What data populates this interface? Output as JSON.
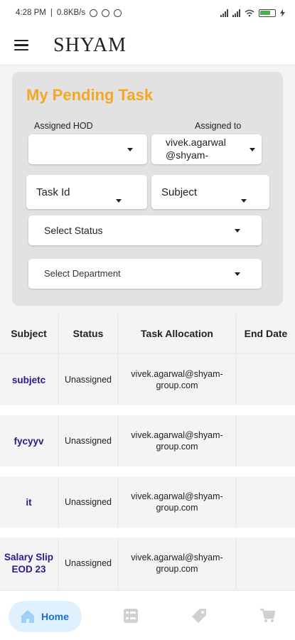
{
  "status_bar": {
    "time": "4:28 PM",
    "speed": "0.8KB/s",
    "battery": "71"
  },
  "app_bar": {
    "brand": "SHYAM"
  },
  "filters": {
    "title": "My Pending Task",
    "assigned_hod_label": "Assigned HOD",
    "assigned_hod_value": "",
    "assigned_to_label": "Assigned to",
    "assigned_to_value_line1": "vivek.agarwal",
    "assigned_to_value_line2": "@shyam-",
    "task_id_placeholder": "Task Id",
    "subject_placeholder": "Subject",
    "status_placeholder": "Select Status",
    "department_placeholder": "Select Department"
  },
  "table": {
    "headers": [
      "Subject",
      "Status",
      "Task Allocation",
      "End Date"
    ],
    "rows": [
      {
        "subject": "subjetc",
        "status": "Unassigned",
        "alloc_line1": "vivek.agarwal@shyam-",
        "alloc_line2": "group.com",
        "end_date": ""
      },
      {
        "subject": "fycyyv",
        "status": "Unassigned",
        "alloc_line1": "vivek.agarwal@shyam-",
        "alloc_line2": "group.com",
        "end_date": ""
      },
      {
        "subject": "it",
        "status": "Unassigned",
        "alloc_line1": "vivek.agarwal@shyam-",
        "alloc_line2": "group.com",
        "end_date": ""
      },
      {
        "subject_line1": "Salary Slip",
        "subject_line2": "EOD 23",
        "status": "Unassigned",
        "alloc_line1": "vivek.agarwal@shyam-",
        "alloc_line2": "group.com",
        "end_date": ""
      }
    ]
  },
  "bottom_nav": {
    "home_label": "Home",
    "items": [
      "home-icon",
      "tasks-icon",
      "tag-icon",
      "cart-icon"
    ]
  },
  "colors": {
    "accent": "#f5a623",
    "subject_text": "#2a1a8c",
    "nav_active": "#1a6fd1",
    "nav_active_bg": "#dff0ff"
  }
}
